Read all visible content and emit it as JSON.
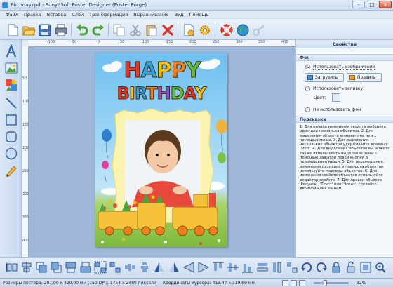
{
  "window": {
    "title": "Birthday.rpd - RonyaSoft Poster Designer (Poster Forge)",
    "controls": [
      "–",
      "□",
      "×"
    ]
  },
  "menu": [
    "Файл",
    "Правка",
    "Вставка",
    "Слои",
    "Трансформация",
    "Выравнивание",
    "Вид",
    "Помощь"
  ],
  "toolbar": {
    "icons": [
      "new-document-icon",
      "open-folder-icon",
      "save-icon",
      "print-icon",
      "undo-icon",
      "redo-icon",
      "copy-icon",
      "cut-icon",
      "paste-icon",
      "delete-icon",
      "page-setup-icon",
      "settings-gear-icon",
      "lifebuoy-help-icon",
      "globe-website-icon",
      "key-register-icon"
    ]
  },
  "left_tools": [
    "text-tool-icon",
    "image-tool-icon",
    "clipart-tool-icon",
    "line-tool-icon",
    "rectangle-tool-icon",
    "rounded-rectangle-tool-icon",
    "ellipse-tool-icon",
    "pencil-tool-icon"
  ],
  "rulers": {
    "horizontal": [
      "-100",
      "-50",
      "0",
      "50",
      "100",
      "150",
      "200",
      "250",
      "300",
      "350",
      "400"
    ],
    "vertical": [
      "50",
      "100",
      "150",
      "200",
      "250",
      "300",
      "350",
      "400"
    ]
  },
  "poster": {
    "headline_1": "HAPPY",
    "headline_2": "BIRTHDAY",
    "headline_1_colors": [
      "#e8342b",
      "#29a3e0",
      "#f2c20f",
      "#ef7f1a",
      "#5fbf3b"
    ],
    "headline_2_colors": [
      "#e8342b",
      "#f2c20f",
      "#29a3e0",
      "#ef7f1a",
      "#8e4fc0",
      "#5fbf3b",
      "#e8342b",
      "#f2c20f"
    ]
  },
  "panel": {
    "title": "Свойства",
    "background_section": "Фон",
    "option_image": "Использовать изображение",
    "load_button": "Загрузить",
    "edit_button": "Править",
    "option_gradient": "Использовать заливку",
    "color_label": "Цвет:",
    "color_value": "#e3eefb",
    "option_none": "Не использовать фон",
    "hint_section": "Подсказка",
    "hint_text": "1. Для начала изменения свойств выберите один или несколько объектов. 2. Для выделения объекта кликните на нем с помощью мыши. 3. Для выделения нескольких объектов удерживайте клавишу 'Shift'. 4. Для выделения объектов вы можете также использовать выделение зоны с помощью зажатой левой кнопки и перемещения мыши. 5. Для перемещения, изменения размеров и поворота объектов используйте маркеры объектов. 6. Для изменения свойств объектов используйте редактор свойств. 7. Для правки объекта 'Рисунок', 'Текст' или 'Эскиз', сделайте двойной клик на нем."
  },
  "bottom_tools": [
    "align-left-edges-icon",
    "align-centers-icon",
    "bring-forward-icon",
    "send-backward-icon",
    "bring-to-front-icon",
    "send-to-back-icon",
    "group-icon",
    "ungroup-icon",
    "distribute-horizontally-icon",
    "distribute-vertically-icon",
    "flip-horizontal-icon",
    "flip-vertical-icon",
    "mirror-left-icon",
    "mirror-right-icon",
    "align-top-icon",
    "align-middle-icon",
    "align-bottom-icon",
    "same-width-icon",
    "same-height-icon",
    "same-size-icon",
    "rotate-left-icon",
    "rotate-right-icon",
    "lock-icon",
    "unlock-icon",
    "fit-page-icon",
    "zoom-in-icon"
  ],
  "status": {
    "poster_size": "Размеры постера: 297,00 x 420,00 мм (150 DPI); 1754 x 2480 пиксели",
    "cursor": "Координаты курсора: 413,47 x 319,69 мм",
    "zoom": "32%",
    "zoom_level": 0.32
  }
}
